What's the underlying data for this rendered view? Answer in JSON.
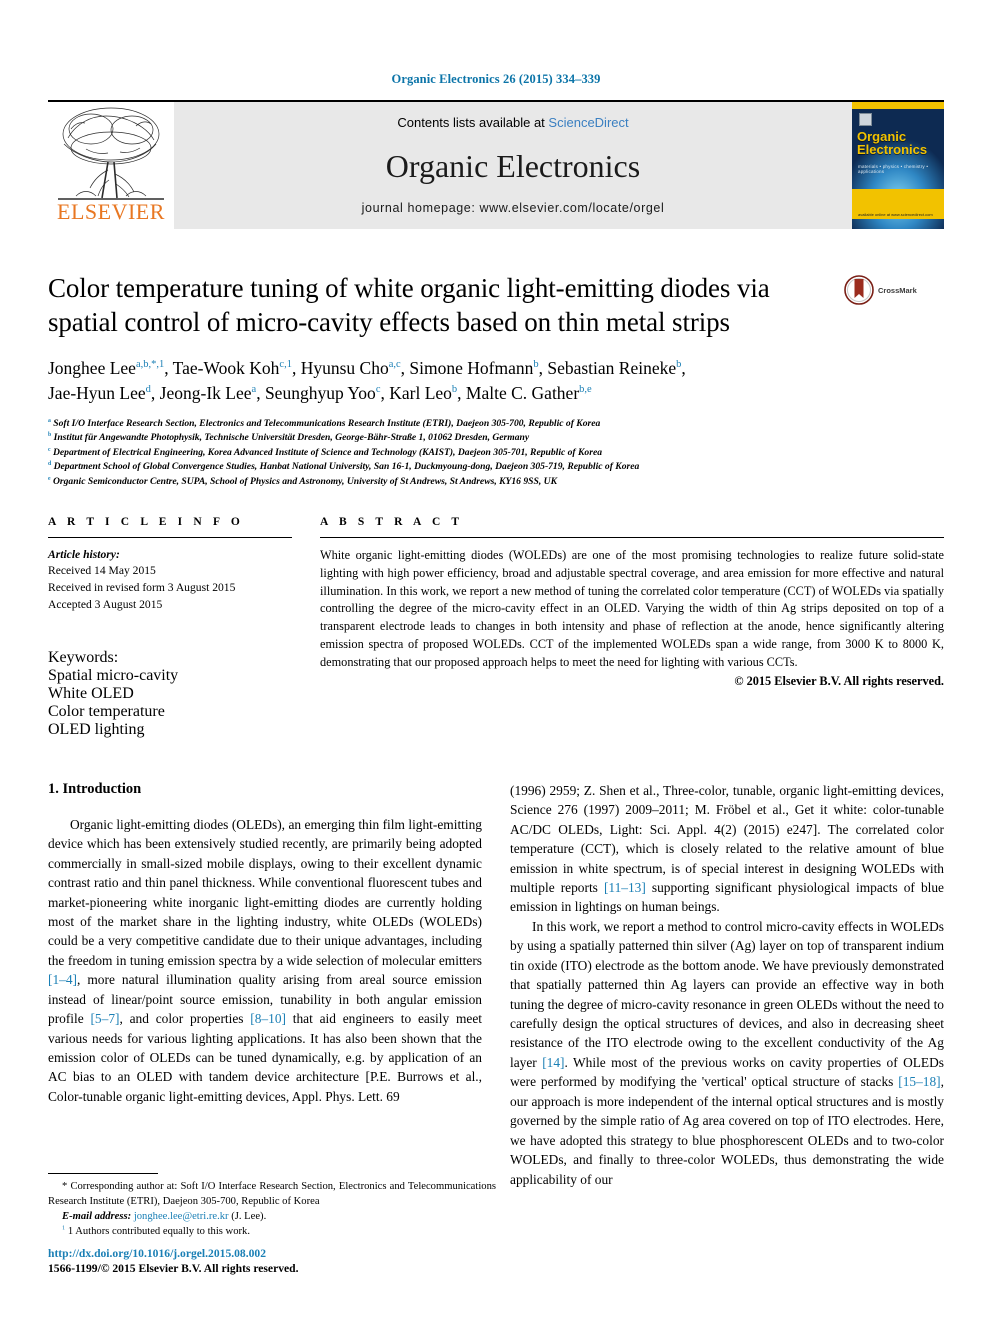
{
  "running_head": "Organic Electronics 26 (2015) 334–339",
  "masthead": {
    "publisher": "ELSEVIER",
    "contents_prefix": "Contents lists available at",
    "contents_link": "ScienceDirect",
    "journal_title": "Organic Electronics",
    "homepage": "journal homepage: www.elsevier.com/locate/orgel",
    "cover_title_line1": "Organic",
    "cover_title_line2": "Electronics",
    "cover_subtitle": "materials • physics • chemistry • applications",
    "cover_footer": "available online at www.sciencedirect.com"
  },
  "article": {
    "title": "Color temperature tuning of white organic light-emitting diodes via spatial control of micro-cavity effects based on thin metal strips",
    "crossmark_label": "CrossMark",
    "authors_line1": "Jonghee Lee a,b,*,1, Tae-Wook Koh c,1, Hyunsu Cho a,c, Simone Hofmann b, Sebastian Reineke b,",
    "authors_line2": "Jae-Hyun Lee d, Jeong-Ik Lee a, Seunghyup Yoo c, Karl Leo b, Malte C. Gather b,e",
    "affiliations": [
      "a Soft I/O Interface Research Section, Electronics and Telecommunications Research Institute (ETRI), Daejeon 305-700, Republic of Korea",
      "b Institut für Angewandte Photophysik, Technische Universität Dresden, George-Bähr-Straße 1, 01062 Dresden, Germany",
      "c Department of Electrical Engineering, Korea Advanced Institute of Science and Technology (KAIST), Daejeon 305-701, Republic of Korea",
      "d Department School of Global Convergence Studies, Hanbat National University, San 16-1, Duckmyoung-dong, Daejeon 305-719, Republic of Korea",
      "e Organic Semiconductor Centre, SUPA, School of Physics and Astronomy, University of St Andrews, St Andrews, KY16 9SS, UK"
    ]
  },
  "article_info": {
    "heading": "A R T I C L E   I N F O",
    "history_label": "Article history:",
    "history": [
      "Received 14 May 2015",
      "Received in revised form 3 August 2015",
      "Accepted 3 August 2015"
    ],
    "keywords_label": "Keywords:",
    "keywords": [
      "Spatial micro-cavity",
      "White OLED",
      "Color temperature",
      "OLED lighting"
    ]
  },
  "abstract": {
    "heading": "A B S T R A C T",
    "text": "White organic light-emitting diodes (WOLEDs) are one of the most promising technologies to realize future solid-state lighting with high power efficiency, broad and adjustable spectral coverage, and area emission for more effective and natural illumination. In this work, we report a new method of tuning the correlated color temperature (CCT) of WOLEDs via spatially controlling the degree of the micro-cavity effect in an OLED. Varying the width of thin Ag strips deposited on top of a transparent electrode leads to changes in both intensity and phase of reflection at the anode, hence significantly altering emission spectra of proposed WOLEDs. CCT of the implemented WOLEDs span a wide range, from 3000 K to 8000 K, demonstrating that our proposed approach helps to meet the need for lighting with various CCTs.",
    "copyright": "© 2015 Elsevier B.V. All rights reserved."
  },
  "body": {
    "section_heading": "1. Introduction",
    "left_para_1": "Organic light-emitting diodes (OLEDs), an emerging thin film light-emitting device which has been extensively studied recently, are primarily being adopted commercially in small-sized mobile displays, owing to their excellent dynamic contrast ratio and thin panel thickness. While conventional fluorescent tubes and market-pioneering white inorganic light-emitting diodes are currently holding most of the market share in the lighting industry, white OLEDs (WOLEDs) could be a very competitive candidate due to their unique advantages, including the freedom in tuning emission spectra by a wide selection of molecular emitters ",
    "ref_1_4": "[1–4]",
    "left_para_1b": ", more natural illumination quality arising from areal source emission instead of linear/point source emission, tunability in both angular emission profile ",
    "ref_5_7": "[5–7]",
    "left_para_1c": ", and color properties ",
    "ref_8_10": "[8–10]",
    "left_para_1d": " that aid engineers to easily meet various needs for various lighting applications. It has also been shown that the emission color of OLEDs can be tuned dynamically, e.g. by application of an AC bias to an OLED with tandem device architecture [P.E. Burrows et al., Color-tunable organic light-emitting  devices, Appl. Phys. Lett. 69",
    "right_para_1": "(1996) 2959; Z. Shen et al., Three-color, tunable, organic light-emitting devices, Science 276 (1997) 2009–2011; M. Fröbel et al., Get it white: color-tunable AC/DC OLEDs, Light:   Sci. Appl. 4(2) (2015) e247]. The correlated color temperature (CCT), which is closely related to the relative amount of blue emission in white spectrum, is of special interest in designing WOLEDs with multiple reports ",
    "ref_11_13": "[11–13]",
    "right_para_1b": " supporting significant physiological impacts of blue emission in lightings on human beings.",
    "right_para_2": "In this work, we report a method to control micro-cavity effects in WOLEDs by using a spatially patterned thin silver (Ag) layer on top of transparent indium tin oxide (ITO) electrode as the bottom anode. We have previously demonstrated that spatially patterned thin Ag layers can provide an effective way in both tuning the degree of micro-cavity resonance in green OLEDs without the need to carefully design the optical structures of devices, and also in decreasing sheet resistance of the ITO electrode owing to the excellent conductivity of the Ag layer ",
    "ref_14": "[14]",
    "right_para_2b": ". While most of the previous works on cavity properties of OLEDs were performed by modifying the 'vertical' optical structure of stacks ",
    "ref_15_18": "[15–18]",
    "right_para_2c": ", our approach is more independent of the internal optical structures and is mostly governed by the simple ratio of Ag area covered on top of ITO electrodes. Here, we have adopted this strategy to blue phosphorescent OLEDs and to two-color WOLEDs, and finally to three-color WOLEDs, thus demonstrating the wide applicability of our"
  },
  "footnotes": {
    "corresponding": "* Corresponding author at: Soft I/O Interface Research Section, Electronics and Telecommunications Research Institute (ETRI), Daejeon 305-700, Republic of Korea",
    "email_label": "E-mail address:",
    "email": "jonghee.lee@etri.re.kr",
    "email_suffix": "(J. Lee).",
    "equal_contrib": "1  Authors contributed equally to this work.",
    "doi": "http://dx.doi.org/10.1016/j.orgel.2015.08.002",
    "issn": "1566-1199/© 2015 Elsevier B.V. All rights reserved."
  },
  "colors": {
    "link_blue": "#1a7fb5",
    "elsevier_orange": "#e87722",
    "cover_yellow": "#f2c200",
    "masthead_grey": "#e8e8e8"
  }
}
